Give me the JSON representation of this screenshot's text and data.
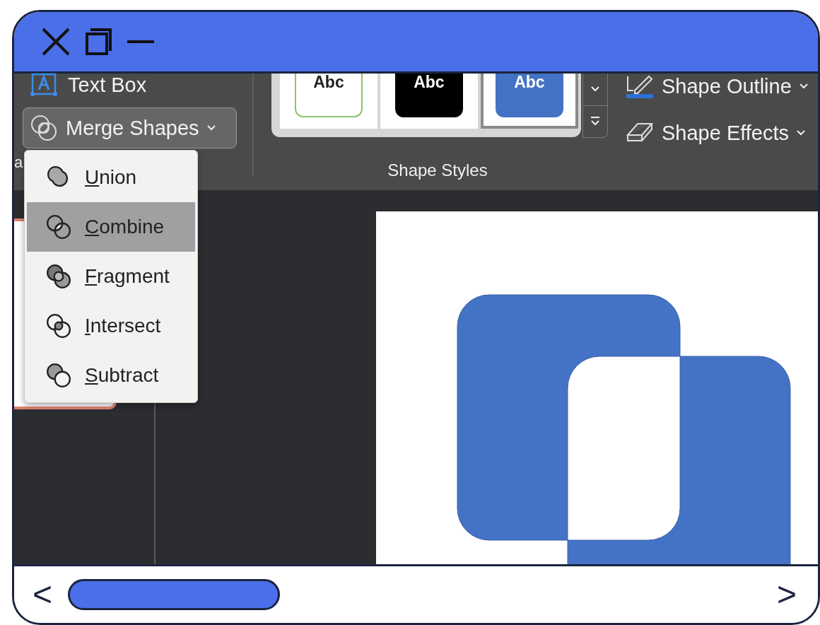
{
  "ribbon": {
    "text_box": {
      "label": "Text Box"
    },
    "merge_shapes": {
      "label": "Merge Shapes",
      "expanded": true
    },
    "group_label": "a",
    "shape_styles": {
      "label": "Shape Styles",
      "swatches": [
        {
          "label": "Abc",
          "kind": "outline",
          "selected": false
        },
        {
          "label": "Abc",
          "kind": "black",
          "selected": false
        },
        {
          "label": "Abc",
          "kind": "blue",
          "selected": true
        }
      ]
    },
    "shape_outline": {
      "label": "Shape Outline"
    },
    "shape_effects": {
      "label": "Shape Effects"
    }
  },
  "merge_menu": {
    "items": [
      {
        "label": "Union",
        "kind": "union",
        "selected": false
      },
      {
        "label": "Combine",
        "kind": "combine",
        "selected": true
      },
      {
        "label": "Fragment",
        "kind": "fragment",
        "selected": false
      },
      {
        "label": "Intersect",
        "kind": "intersect",
        "selected": false
      },
      {
        "label": "Subtract",
        "kind": "subtract",
        "selected": false
      }
    ]
  },
  "scrollbar": {
    "left": "<",
    "right": ">"
  }
}
